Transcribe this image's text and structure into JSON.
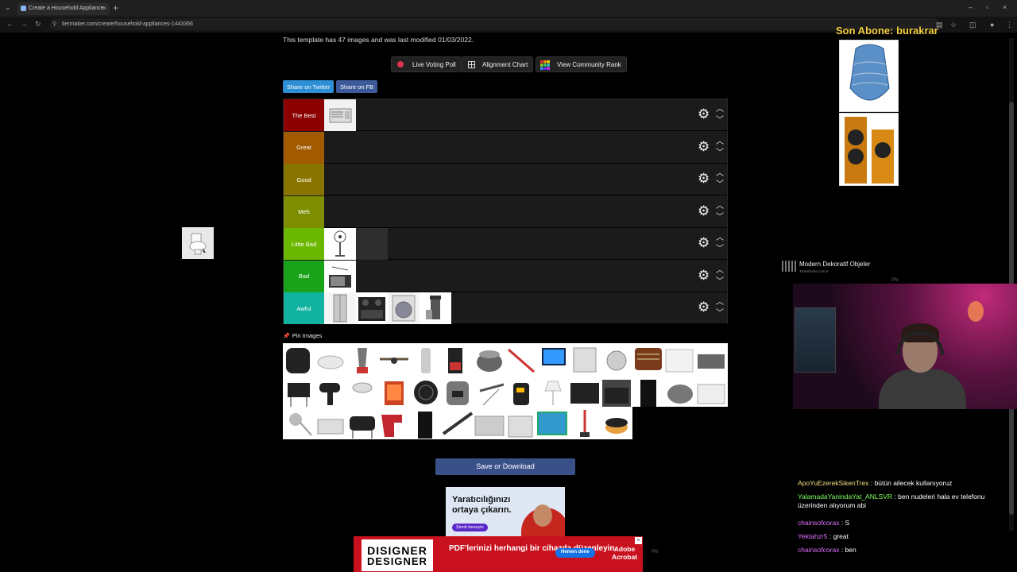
{
  "browser": {
    "tab_title": "Create a Household Appliance",
    "url": "tiermaker.com/create/household-appliances-1443366"
  },
  "page": {
    "info_text": "This template has 47 images and was last modified 01/03/2022.",
    "buttons": {
      "live_voting": "Live Voting Poll",
      "alignment_chart": "Alignment Chart",
      "community_rank": "View Community Rank"
    },
    "share": {
      "twitter": "Share on Twitter",
      "fb": "Share on FB"
    },
    "tiers": [
      {
        "label": "The Best",
        "color": "#8c0000"
      },
      {
        "label": "Great",
        "color": "#a15a00"
      },
      {
        "label": "Good",
        "color": "#8a7400"
      },
      {
        "label": "Meh",
        "color": "#7d8f00"
      },
      {
        "label": "Little Bad",
        "color": "#6cb800"
      },
      {
        "label": "Bad",
        "color": "#1aa31a"
      },
      {
        "label": "Awful",
        "color": "#11b3a0"
      }
    ],
    "pinned_label": "Pin Images",
    "save_button": "Save or Download"
  },
  "ads": {
    "top_ad_text": "Yaratıcılığınızı ortaya çıkarın.",
    "top_ad_cta": "Şimdi deneyin",
    "bottom_ad_logo": "DISIGNER",
    "bottom_ad_logo_sub": "DESIGNER",
    "bottom_ad_text": "PDF'lerinizi herhangi bir cihazda düzenleyin.",
    "bottom_ad_cta": "Hemen dene",
    "bottom_ad_brand": "Adobe Acrobat",
    "pn": "PN"
  },
  "stream": {
    "title": "Son Abone: burakrar",
    "shop_name": "Modern Dekoratif Objeler",
    "shop_url": "Twinshome.com.tr",
    "pn": "PN",
    "chat": [
      {
        "user": "ApoYuEzerekSikenTrex",
        "msg": ": bütün ailecek kullanıyoruz",
        "color": "u1"
      },
      {
        "user": "YalamadaYanindaYat_ANLSVR",
        "msg": ": ben nudeleri hala ev telefonu üzerinden alıyorum abi",
        "color": "u2"
      },
      {
        "user": "chainsofcorax",
        "msg": ": S",
        "color": "u3"
      },
      {
        "user": "Yektahzr5",
        "msg": ": great",
        "color": "u3"
      },
      {
        "user": "chainsofcorax",
        "msg": ": ben",
        "color": "u3"
      }
    ]
  }
}
